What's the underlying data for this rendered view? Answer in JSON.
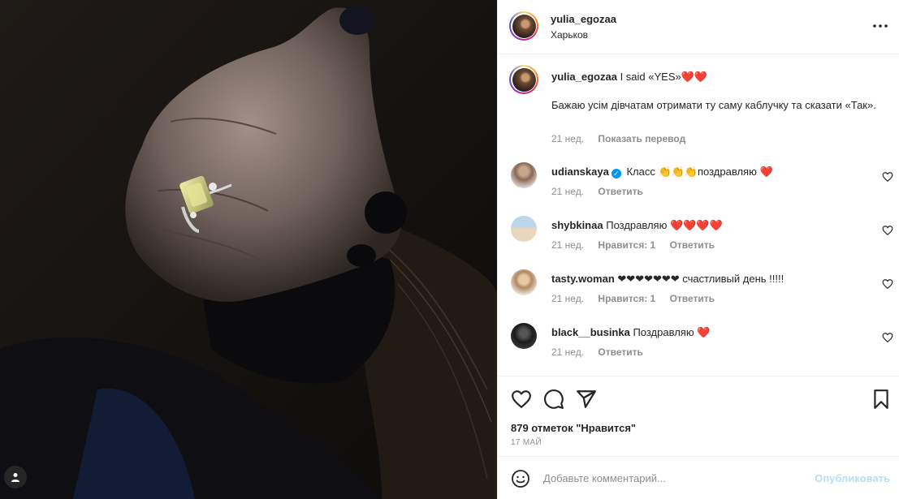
{
  "post": {
    "username": "yulia_egozaa",
    "location": "Харьков"
  },
  "caption": {
    "username": "yulia_egozaa",
    "text": "I said «YES»❤️❤️",
    "body": "Бажаю усім дівчатам отримати ту саму каблучку та сказати «Так».",
    "time": "21 нед.",
    "translate": "Показать перевод"
  },
  "comments": [
    {
      "username": "udianskaya",
      "verified": true,
      "text": "Класс 👏👏👏поздравляю ❤️",
      "time": "21 нед.",
      "likes": "",
      "reply": "Ответить"
    },
    {
      "username": "shybkinaa",
      "verified": false,
      "text": "Поздравляю ❤️❤️❤️❤️",
      "time": "21 нед.",
      "likes": "Нравится: 1",
      "reply": "Ответить"
    },
    {
      "username": "tasty.woman",
      "verified": false,
      "text": "❤❤❤❤❤❤❤ счастливый день !!!!!",
      "time": "21 нед.",
      "likes": "Нравится: 1",
      "reply": "Ответить"
    },
    {
      "username": "black__businka",
      "verified": false,
      "text": "Поздравляю ❤️",
      "time": "21 нед.",
      "likes": "",
      "reply": "Ответить"
    }
  ],
  "actions": {
    "likes_text": "879 отметок \"Нравится\"",
    "date": "17 МАЙ"
  },
  "add_comment": {
    "placeholder": "Добавьте комментарий...",
    "publish": "Опубликовать"
  },
  "icons": {
    "like": "heart-icon",
    "comment": "comment-icon",
    "share": "paper-plane-icon",
    "save": "bookmark-icon",
    "more": "more-horizontal-icon",
    "emoji": "smiley-icon",
    "tags": "user-tag-icon"
  },
  "colors": {
    "verified": "#0095f6",
    "publish_disabled": "#b2dffc",
    "secondary_text": "#8e8e8e"
  }
}
